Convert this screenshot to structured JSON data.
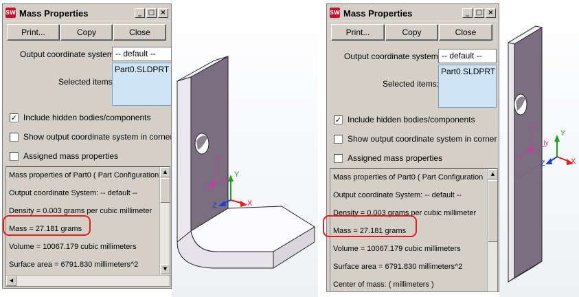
{
  "dialog": {
    "title": "Mass Properties",
    "logo_text": "SW",
    "window_buttons": {
      "minimize": "_",
      "maximize": "□",
      "close": "×"
    },
    "buttons": {
      "print": "Print...",
      "copy": "Copy",
      "close": "Close"
    },
    "output_coordinate_label": "Output coordinate system:",
    "output_coordinate_value": "-- default --",
    "selected_items_label": "Selected items:",
    "selected_item": "Part0.SLDPRT",
    "checkboxes": {
      "include_hidden": {
        "label": "Include hidden bodies/components",
        "checked": true,
        "mark": "✓"
      },
      "show_output_coord": {
        "label": "Show output coordinate system in corner of w",
        "checked": false,
        "mark": ""
      },
      "assigned_mass": {
        "label": "Assigned mass properties",
        "checked": false,
        "mark": ""
      }
    },
    "results": [
      "Mass properties of Part0 ( Part Configuration",
      "Output  coordinate System: -- default --",
      "Density = 0.003 grams per cubic millimeter",
      "Mass = 27.181 grams",
      "Volume = 10067.179 cubic millimeters",
      "Surface area = 6791.830 millimeters^2",
      "Center of mass: ( millimeters )"
    ],
    "scroll_arrows": {
      "up": "▲",
      "down": "▼",
      "left": "◀"
    }
  },
  "viewport": {
    "axis_labels": {
      "x": "X",
      "y": "Y",
      "z": "Z",
      "ix": "Ix",
      "iy": "Iy",
      "iz": "Iz"
    }
  },
  "colors": {
    "dialog_bg": "#d4d0c8",
    "highlight": "#e31b1b",
    "part_face": "#7a6e80",
    "listbox_bg": "#cfe4f6",
    "axis_x": "#e31b1b",
    "axis_y": "#1aa01a",
    "axis_z": "#1a3fd6",
    "principal_axes": "#c0409f"
  }
}
